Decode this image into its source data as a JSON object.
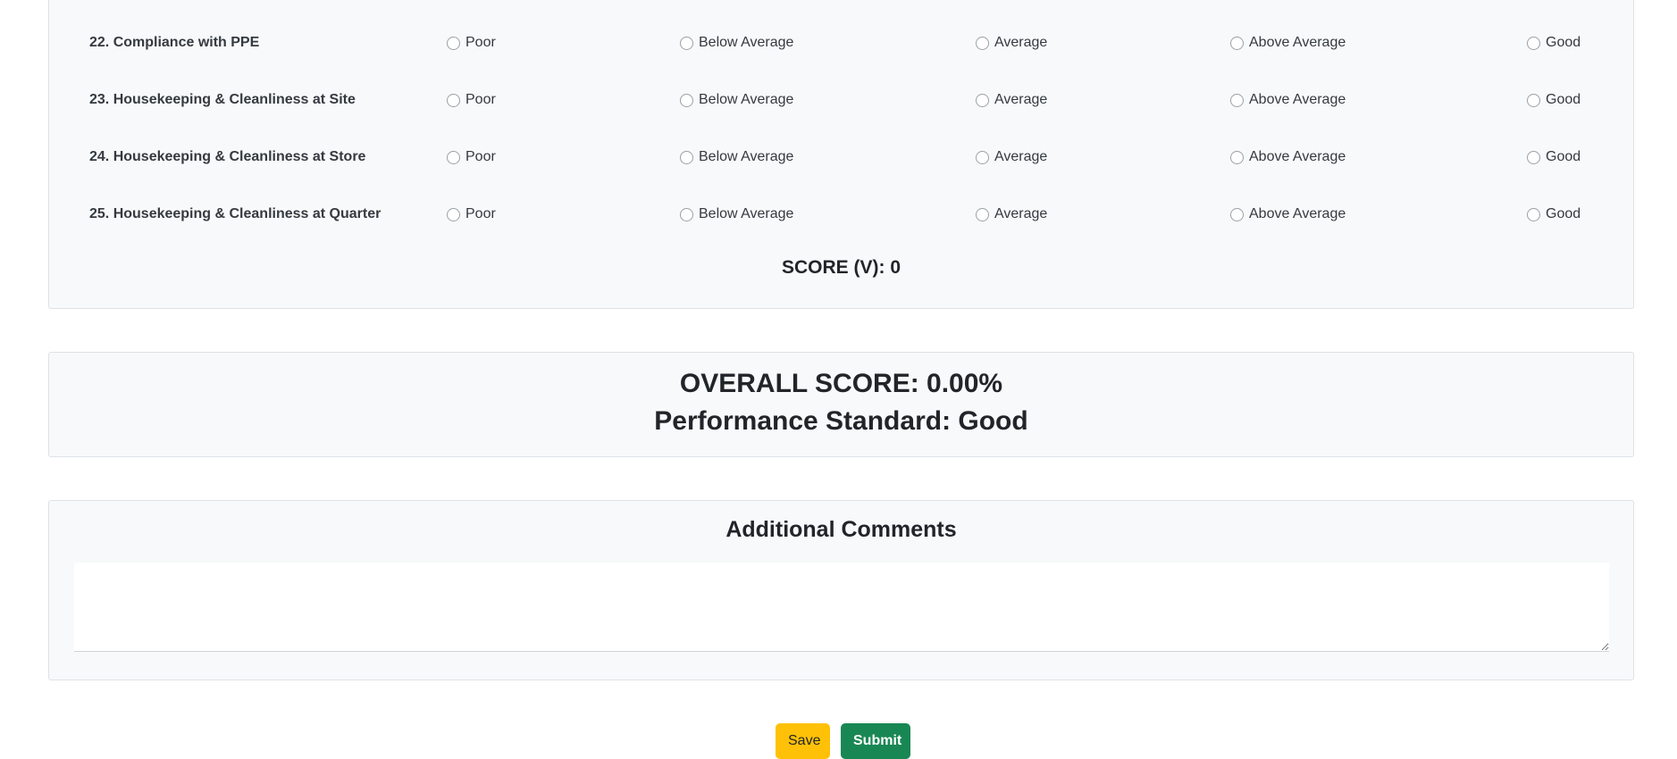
{
  "rating_section": {
    "options": [
      "Poor",
      "Below Average",
      "Average",
      "Above Average",
      "Good"
    ],
    "questions": [
      {
        "label": "22. Compliance with PPE"
      },
      {
        "label": "23. Housekeeping & Cleanliness at Site"
      },
      {
        "label": "24. Housekeeping & Cleanliness at Store"
      },
      {
        "label": "25. Housekeeping & Cleanliness at Quarter"
      }
    ],
    "score_text": "SCORE (V): 0"
  },
  "overall": {
    "score_text": "OVERALL SCORE: 0.00%",
    "standard_text": "Performance Standard: Good"
  },
  "comments": {
    "title": "Additional Comments",
    "value": ""
  },
  "buttons": {
    "save_label": "Save",
    "submit_label": "Submit"
  },
  "colors": {
    "save": "#ffc107",
    "submit": "#198754",
    "panel_bg": "#f8f9fa"
  }
}
